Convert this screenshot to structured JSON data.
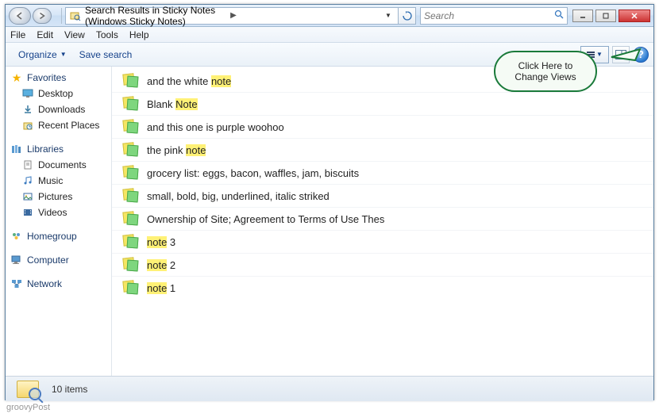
{
  "titlebar": {
    "breadcrumb": "Search Results in Sticky Notes (Windows Sticky Notes)",
    "search_placeholder": "Search"
  },
  "window_controls": {
    "min": "_",
    "max": "□",
    "close": "×"
  },
  "menubar": [
    "File",
    "Edit",
    "View",
    "Tools",
    "Help"
  ],
  "toolbar": {
    "organize": "Organize",
    "save_search": "Save search"
  },
  "callout": {
    "text": "Click Here to Change Views"
  },
  "sidebar": {
    "favorites": {
      "label": "Favorites",
      "items": [
        "Desktop",
        "Downloads",
        "Recent Places"
      ]
    },
    "libraries": {
      "label": "Libraries",
      "items": [
        "Documents",
        "Music",
        "Pictures",
        "Videos"
      ]
    },
    "homegroup": {
      "label": "Homegroup"
    },
    "computer": {
      "label": "Computer"
    },
    "network": {
      "label": "Network"
    }
  },
  "results": [
    {
      "parts": [
        {
          "t": "and the white "
        },
        {
          "t": "note",
          "hl": true
        }
      ]
    },
    {
      "parts": [
        {
          "t": "Blank "
        },
        {
          "t": "Note",
          "hl": true
        }
      ]
    },
    {
      "parts": [
        {
          "t": "and this one is purple woohoo"
        }
      ]
    },
    {
      "parts": [
        {
          "t": "the pink "
        },
        {
          "t": "note",
          "hl": true
        }
      ]
    },
    {
      "parts": [
        {
          "t": "grocery list: eggs, bacon, waffles, jam, biscuits"
        }
      ]
    },
    {
      "parts": [
        {
          "t": "small, bold,  big,  underlined, italic striked"
        }
      ]
    },
    {
      "parts": [
        {
          "t": "Ownership of Site; Agreement to Terms of Use Thes"
        }
      ]
    },
    {
      "parts": [
        {
          "t": "note",
          "hl": true
        },
        {
          "t": " 3"
        }
      ]
    },
    {
      "parts": [
        {
          "t": "note",
          "hl": true
        },
        {
          "t": " 2"
        }
      ]
    },
    {
      "parts": [
        {
          "t": "note",
          "hl": true
        },
        {
          "t": " 1"
        }
      ]
    }
  ],
  "status": {
    "count_text": "10 items"
  },
  "watermark": "groovyPost"
}
